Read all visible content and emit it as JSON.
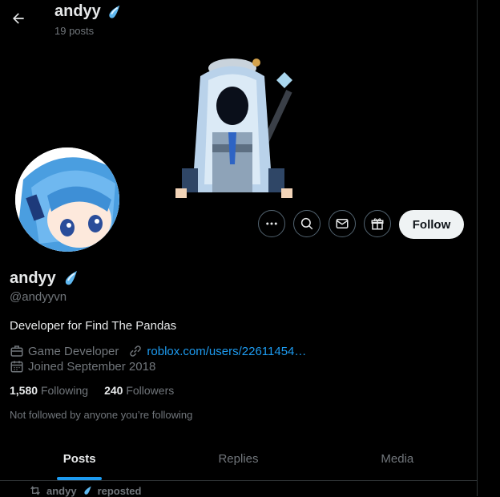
{
  "header": {
    "name": "andyy",
    "post_count": "19 posts"
  },
  "profile": {
    "display_name": "andyy",
    "handle": "@andyyvn",
    "bio": "Developer for Find The Pandas",
    "category": "Game Developer",
    "link": "roblox.com/users/22611454…",
    "joined": "Joined September 2018",
    "following_count": "1,580",
    "following_label": "Following",
    "followers_count": "240",
    "followers_label": "Followers",
    "not_followed_text": "Not followed by anyone you’re following"
  },
  "actions": {
    "follow_label": "Follow"
  },
  "tabs": [
    {
      "label": "Posts",
      "active": true
    },
    {
      "label": "Replies",
      "active": false
    },
    {
      "label": "Media",
      "active": false
    }
  ],
  "repost": {
    "user": "andyy",
    "label": "reposted"
  },
  "colors": {
    "accent": "#1d9bf0",
    "background": "#000000",
    "muted": "#71767b"
  }
}
